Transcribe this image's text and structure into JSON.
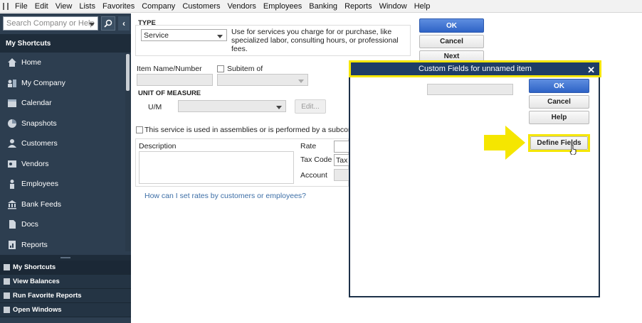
{
  "menubar": {
    "items": [
      "File",
      "Edit",
      "View",
      "Lists",
      "Favorites",
      "Company",
      "Customers",
      "Vendors",
      "Employees",
      "Banking",
      "Reports",
      "Window",
      "Help"
    ]
  },
  "sidebar": {
    "search_placeholder": "Search Company or Help",
    "header": "My Shortcuts",
    "items": [
      {
        "label": "Home",
        "icon": "home-icon"
      },
      {
        "label": "My Company",
        "icon": "company-icon"
      },
      {
        "label": "Calendar",
        "icon": "calendar-icon"
      },
      {
        "label": "Snapshots",
        "icon": "pie-chart-icon"
      },
      {
        "label": "Customers",
        "icon": "customer-icon"
      },
      {
        "label": "Vendors",
        "icon": "vendor-icon"
      },
      {
        "label": "Employees",
        "icon": "employees-icon"
      },
      {
        "label": "Bank Feeds",
        "icon": "bank-icon"
      },
      {
        "label": "Docs",
        "icon": "document-icon"
      },
      {
        "label": "Reports",
        "icon": "reports-icon"
      }
    ],
    "bottom_items": [
      "My Shortcuts",
      "View Balances",
      "Run Favorite Reports",
      "Open Windows"
    ]
  },
  "form": {
    "type_label": "TYPE",
    "type_value": "Service",
    "type_description": "Use for services you charge for or purchase, like specialized labor, consulting hours, or professional fees.",
    "item_name_label": "Item Name/Number",
    "subitem_label": "Subitem of",
    "unit_of_measure_label": "UNIT OF MEASURE",
    "um_label": "U/M",
    "edit_button": "Edit...",
    "assemblies_checkbox_label": "This service is used in assemblies or is performed by a subcontractor",
    "description_label": "Description",
    "rate_label": "Rate",
    "tax_code_label": "Tax Code",
    "tax_code_value": "Tax",
    "account_label": "Account",
    "rates_link": "How can I set rates by customers or employees?",
    "buttons": {
      "ok": "OK",
      "cancel": "Cancel",
      "next": "Next"
    }
  },
  "dialog": {
    "title": "Custom Fields for unnamed item",
    "buttons": {
      "ok": "OK",
      "cancel": "Cancel",
      "help": "Help",
      "define_fields": "Define Fields"
    }
  },
  "colors": {
    "highlight": "#f5e600",
    "sidebar_bg": "#2d3e50",
    "primary_button": "#3a6fd1",
    "dialog_title_bg": "#1f3d66"
  }
}
